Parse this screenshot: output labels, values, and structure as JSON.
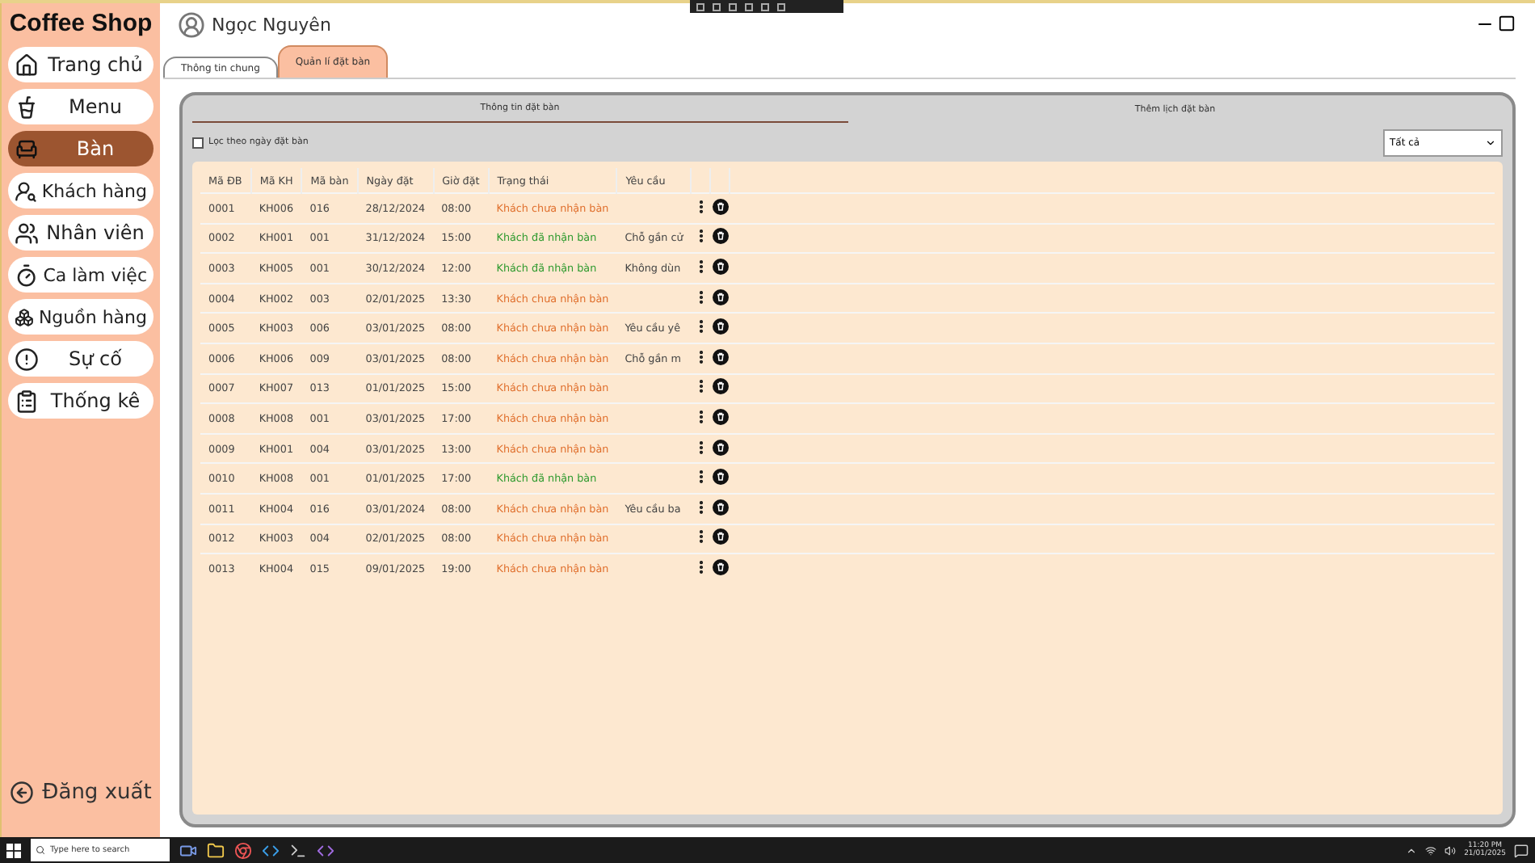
{
  "app": {
    "title": "Coffee Shop"
  },
  "sidebar": {
    "items": [
      {
        "label": "Trang chủ",
        "selected": false
      },
      {
        "label": "Menu",
        "selected": false
      },
      {
        "label": "Bàn",
        "selected": true
      },
      {
        "label": "Khách hàng",
        "selected": false
      },
      {
        "label": "Nhân viên",
        "selected": false
      },
      {
        "label": "Ca làm việc",
        "selected": false
      },
      {
        "label": "Nguồn hàng",
        "selected": false
      },
      {
        "label": "Sự cố",
        "selected": false
      },
      {
        "label": "Thống kê",
        "selected": false
      }
    ],
    "logout": "Đăng xuất"
  },
  "user": {
    "name": "Ngọc Nguyên"
  },
  "tabs": [
    {
      "label": "Thông tin chung",
      "selected": false
    },
    {
      "label": "Quản lí đặt bàn",
      "selected": true
    }
  ],
  "subtabs": [
    {
      "label": "Thông tin đặt bàn",
      "selected": true
    },
    {
      "label": "Thêm lịch đặt bàn",
      "selected": false
    }
  ],
  "filter": {
    "label": "Lọc theo ngày đặt bàn",
    "checked": false
  },
  "dropdown": {
    "value": "Tất cả"
  },
  "table": {
    "columns": [
      "Mã ĐB",
      "Mã KH",
      "Mã bàn",
      "Ngày đặt",
      "Giờ đặt",
      "Trạng thái",
      "Yêu cầu"
    ],
    "rows": [
      {
        "cells": [
          "0001",
          "KH006",
          "016",
          "28/12/2024",
          "08:00",
          "Khách chưa nhận bàn",
          ""
        ],
        "kind": "pending"
      },
      {
        "cells": [
          "0002",
          "KH001",
          "001",
          "31/12/2024",
          "15:00",
          "Khách đã nhận bàn",
          "Chỗ gần cử"
        ],
        "kind": "received"
      },
      {
        "cells": [
          "0003",
          "KH005",
          "001",
          "30/12/2024",
          "12:00",
          "Khách đã nhận bàn",
          "Không dùn"
        ],
        "kind": "received"
      },
      {
        "cells": [
          "0004",
          "KH002",
          "003",
          "02/01/2025",
          "13:30",
          "Khách chưa nhận bàn",
          ""
        ],
        "kind": "pending"
      },
      {
        "cells": [
          "0005",
          "KH003",
          "006",
          "03/01/2025",
          "08:00",
          "Khách chưa nhận bàn",
          "Yêu cầu yê"
        ],
        "kind": "pending"
      },
      {
        "cells": [
          "0006",
          "KH006",
          "009",
          "03/01/2025",
          "08:00",
          "Khách chưa nhận bàn",
          "Chỗ gần m"
        ],
        "kind": "pending"
      },
      {
        "cells": [
          "0007",
          "KH007",
          "013",
          "01/01/2025",
          "15:00",
          "Khách chưa nhận bàn",
          ""
        ],
        "kind": "pending"
      },
      {
        "cells": [
          "0008",
          "KH008",
          "001",
          "03/01/2025",
          "17:00",
          "Khách chưa nhận bàn",
          ""
        ],
        "kind": "pending"
      },
      {
        "cells": [
          "0009",
          "KH001",
          "004",
          "03/01/2025",
          "13:00",
          "Khách chưa nhận bàn",
          ""
        ],
        "kind": "pending"
      },
      {
        "cells": [
          "0010",
          "KH008",
          "001",
          "01/01/2025",
          "17:00",
          "Khách đã nhận bàn",
          ""
        ],
        "kind": "received"
      },
      {
        "cells": [
          "0011",
          "KH004",
          "016",
          "03/01/2024",
          "08:00",
          "Khách chưa nhận bàn",
          "Yêu cầu ba"
        ],
        "kind": "pending"
      },
      {
        "cells": [
          "0012",
          "KH003",
          "004",
          "02/01/2025",
          "08:00",
          "Khách chưa nhận bàn",
          ""
        ],
        "kind": "pending"
      },
      {
        "cells": [
          "0013",
          "KH004",
          "015",
          "09/01/2025",
          "19:00",
          "Khách chưa nhận bàn",
          ""
        ],
        "kind": "pending"
      }
    ]
  },
  "taskbar": {
    "search_placeholder": "Type here to search",
    "time": "11:20 PM",
    "date": "21/01/2025"
  }
}
